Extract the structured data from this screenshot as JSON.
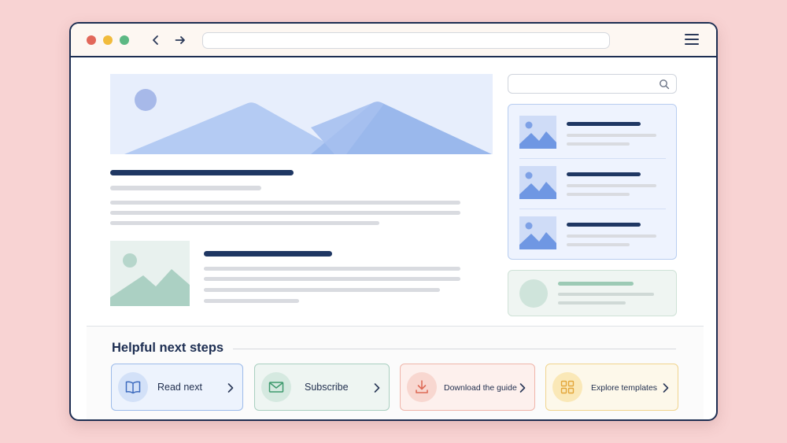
{
  "browser": {
    "address_value": "",
    "controls": [
      "close",
      "minimize",
      "maximize"
    ]
  },
  "sidebar": {
    "search_value": "",
    "search_icon": "search-icon"
  },
  "bottom": {
    "heading": "Helpful next steps",
    "steps": [
      {
        "label": "Read next",
        "icon": "book-icon",
        "color": "#4a78c9"
      },
      {
        "label": "Subscribe",
        "icon": "envelope-icon",
        "color": "#3f9a6e"
      },
      {
        "label": "Download the guide",
        "icon": "download-icon",
        "color": "#de6b57"
      },
      {
        "label": "Explore templates",
        "icon": "grid-icon",
        "color": "#e3a63a"
      }
    ]
  },
  "colors": {
    "background": "#f8d3d3",
    "frame": "#1d2e52",
    "accent_blue": "#a8c2f0",
    "accent_green": "#a9d3c3"
  }
}
